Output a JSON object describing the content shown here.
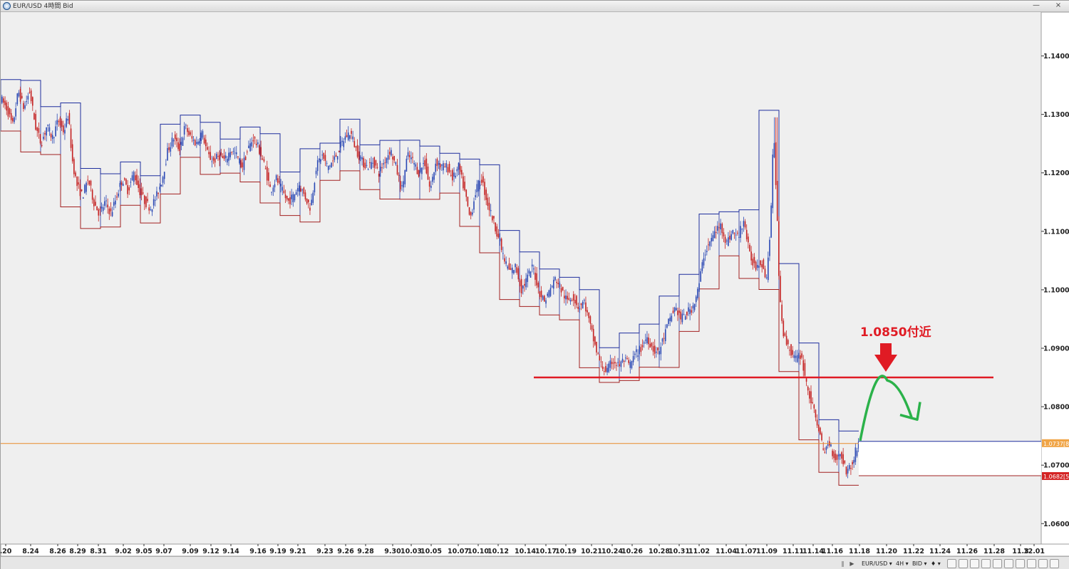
{
  "window": {
    "title": "EUR/USD 4時間 Bid",
    "minimize_label": "—",
    "close_label": "×"
  },
  "toolbar": {
    "symbol": "EUR/USD ▾",
    "period": "4H ▾",
    "price_type": "BID ▾",
    "extra": "♦ ▾",
    "scroll_left": "◀",
    "scroll_right": "▶",
    "pause": "‖"
  },
  "colors": {
    "background": "#efefef",
    "bull": "#2a48b4",
    "bear": "#c42020",
    "upper_band": "#1f2f9e",
    "lower_band": "#a22020",
    "resistance": "#e01b24",
    "arrow_green": "#2bb24a",
    "price_line": "#e88a2a",
    "annotation": "#e01b24"
  },
  "chart_data": {
    "type": "candlestick",
    "symbol": "EUR/USD",
    "timeframe": "4時間",
    "price_type": "Bid",
    "ylim": [
      1.0565,
      1.1475
    ],
    "y_ticks": [
      "1.1400[0]",
      "1.1300[0]",
      "1.1200[0]",
      "1.1100[0]",
      "1.1000[0]",
      "1.0900[0]",
      "1.0800[0]",
      "1.0700[0]",
      "1.0600[0]"
    ],
    "y_tick_values": [
      1.14,
      1.13,
      1.12,
      1.11,
      1.1,
      1.09,
      1.08,
      1.07,
      1.06
    ],
    "x_ticks": [
      ".20",
      "8.24",
      "8.26",
      "8.29",
      "8.31",
      "9.02",
      "9.05",
      "9.07",
      "9.09",
      "9.12",
      "9.14",
      "9.16",
      "9.19",
      "9.21",
      "9.23",
      "9.26",
      "9.28",
      "9.30",
      "10.03",
      "10.05",
      "10.07",
      "10.10",
      "10.12",
      "10.14",
      "10.17",
      "10.19",
      "10.21",
      "10.24",
      "10.26",
      "10.28",
      "10.31",
      "11.02",
      "11.04",
      "11.07",
      "11.09",
      "11.11",
      "11.14",
      "11.16",
      "11.18",
      "11.20",
      "11.22",
      "11.24",
      "11.26",
      "11.28",
      "11.3",
      "12.01"
    ],
    "x_tick_positions": [
      7,
      42,
      80,
      108,
      137,
      172,
      201,
      229,
      266,
      295,
      323,
      361,
      389,
      417,
      455,
      484,
      512,
      550,
      576,
      604,
      642,
      670,
      698,
      736,
      765,
      793,
      829,
      858,
      886,
      924,
      952,
      980,
      1018,
      1046,
      1075,
      1112,
      1140,
      1167,
      1205,
      1243,
      1281,
      1318,
      1356,
      1394,
      1431,
      1450
    ],
    "current_price": {
      "label": "1.0737[8]",
      "value": 1.0737
    },
    "lower_price": {
      "label": "1.0682[5]",
      "value": 1.0682
    },
    "resistance": {
      "label": "1.0850付近",
      "value": 1.085
    },
    "price_path": [
      [
        0,
        1.133
      ],
      [
        10,
        1.131
      ],
      [
        18,
        1.128
      ],
      [
        26,
        1.134
      ],
      [
        34,
        1.131
      ],
      [
        42,
        1.134
      ],
      [
        50,
        1.128
      ],
      [
        58,
        1.125
      ],
      [
        66,
        1.128
      ],
      [
        74,
        1.126
      ],
      [
        82,
        1.129
      ],
      [
        90,
        1.127
      ],
      [
        96,
        1.13
      ],
      [
        102,
        1.122
      ],
      [
        108,
        1.118
      ],
      [
        116,
        1.116
      ],
      [
        124,
        1.119
      ],
      [
        132,
        1.115
      ],
      [
        140,
        1.113
      ],
      [
        148,
        1.115
      ],
      [
        156,
        1.113
      ],
      [
        164,
        1.116
      ],
      [
        172,
        1.119
      ],
      [
        180,
        1.117
      ],
      [
        188,
        1.12
      ],
      [
        196,
        1.117
      ],
      [
        204,
        1.115
      ],
      [
        212,
        1.114
      ],
      [
        220,
        1.116
      ],
      [
        228,
        1.119
      ],
      [
        236,
        1.124
      ],
      [
        244,
        1.126
      ],
      [
        252,
        1.124
      ],
      [
        260,
        1.128
      ],
      [
        268,
        1.126
      ],
      [
        276,
        1.125
      ],
      [
        284,
        1.127
      ],
      [
        292,
        1.123
      ],
      [
        300,
        1.122
      ],
      [
        308,
        1.123
      ],
      [
        316,
        1.122
      ],
      [
        324,
        1.124
      ],
      [
        332,
        1.123
      ],
      [
        340,
        1.121
      ],
      [
        348,
        1.124
      ],
      [
        356,
        1.126
      ],
      [
        364,
        1.124
      ],
      [
        372,
        1.121
      ],
      [
        380,
        1.117
      ],
      [
        388,
        1.119
      ],
      [
        396,
        1.117
      ],
      [
        404,
        1.115
      ],
      [
        412,
        1.116
      ],
      [
        420,
        1.118
      ],
      [
        428,
        1.116
      ],
      [
        436,
        1.114
      ],
      [
        444,
        1.121
      ],
      [
        452,
        1.123
      ],
      [
        460,
        1.121
      ],
      [
        468,
        1.122
      ],
      [
        476,
        1.124
      ],
      [
        484,
        1.126
      ],
      [
        492,
        1.127
      ],
      [
        500,
        1.124
      ],
      [
        508,
        1.122
      ],
      [
        516,
        1.121
      ],
      [
        524,
        1.122
      ],
      [
        532,
        1.12
      ],
      [
        540,
        1.122
      ],
      [
        548,
        1.124
      ],
      [
        556,
        1.121
      ],
      [
        564,
        1.117
      ],
      [
        572,
        1.123
      ],
      [
        580,
        1.122
      ],
      [
        588,
        1.12
      ],
      [
        596,
        1.122
      ],
      [
        604,
        1.117
      ],
      [
        612,
        1.122
      ],
      [
        620,
        1.121
      ],
      [
        628,
        1.121
      ],
      [
        636,
        1.119
      ],
      [
        644,
        1.121
      ],
      [
        652,
        1.117
      ],
      [
        660,
        1.112
      ],
      [
        668,
        1.117
      ],
      [
        676,
        1.119
      ],
      [
        684,
        1.115
      ],
      [
        692,
        1.112
      ],
      [
        700,
        1.109
      ],
      [
        708,
        1.105
      ],
      [
        716,
        1.103
      ],
      [
        724,
        1.104
      ],
      [
        732,
        1.1
      ],
      [
        740,
        1.102
      ],
      [
        748,
        1.104
      ],
      [
        756,
        1.1
      ],
      [
        764,
        1.098
      ],
      [
        772,
        1.1
      ],
      [
        780,
        1.102
      ],
      [
        788,
        1.1
      ],
      [
        796,
        1.098
      ],
      [
        804,
        1.099
      ],
      [
        812,
        1.097
      ],
      [
        820,
        1.098
      ],
      [
        828,
        1.094
      ],
      [
        836,
        1.09
      ],
      [
        844,
        1.087
      ],
      [
        852,
        1.086
      ],
      [
        860,
        1.088
      ],
      [
        868,
        1.087
      ],
      [
        876,
        1.088
      ],
      [
        884,
        1.087
      ],
      [
        892,
        1.089
      ],
      [
        900,
        1.09
      ],
      [
        908,
        1.092
      ],
      [
        916,
        1.09
      ],
      [
        924,
        1.089
      ],
      [
        932,
        1.092
      ],
      [
        940,
        1.095
      ],
      [
        948,
        1.097
      ],
      [
        956,
        1.095
      ],
      [
        964,
        1.096
      ],
      [
        972,
        1.097
      ],
      [
        980,
        1.1
      ],
      [
        988,
        1.106
      ],
      [
        996,
        1.108
      ],
      [
        1004,
        1.11
      ],
      [
        1012,
        1.111
      ],
      [
        1020,
        1.108
      ],
      [
        1028,
        1.11
      ],
      [
        1036,
        1.109
      ],
      [
        1044,
        1.112
      ],
      [
        1052,
        1.106
      ],
      [
        1060,
        1.104
      ],
      [
        1068,
        1.105
      ],
      [
        1076,
        1.102
      ],
      [
        1082,
        1.112
      ],
      [
        1086,
        1.128
      ],
      [
        1090,
        1.115
      ],
      [
        1094,
        1.1
      ],
      [
        1100,
        1.092
      ],
      [
        1108,
        1.09
      ],
      [
        1116,
        1.088
      ],
      [
        1124,
        1.089
      ],
      [
        1132,
        1.084
      ],
      [
        1140,
        1.08
      ],
      [
        1148,
        1.077
      ],
      [
        1156,
        1.072
      ],
      [
        1164,
        1.074
      ],
      [
        1172,
        1.071
      ],
      [
        1180,
        1.072
      ],
      [
        1188,
        1.069
      ],
      [
        1196,
        1.07
      ],
      [
        1204,
        1.0738
      ]
    ]
  },
  "annotations": {
    "target_label": "1.0850付近"
  }
}
